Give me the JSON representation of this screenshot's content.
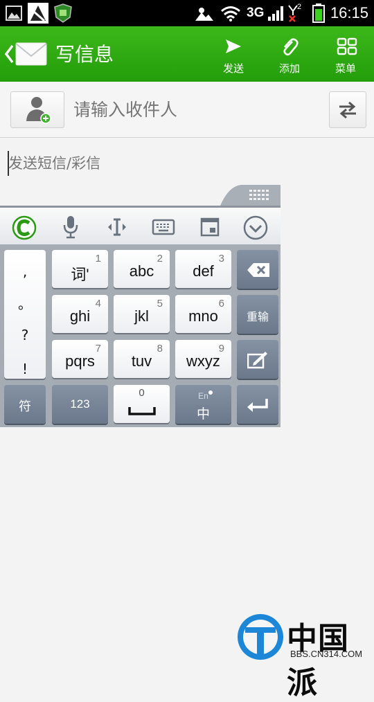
{
  "status_bar": {
    "network": "3G",
    "sim": "2",
    "time": "16:15"
  },
  "header": {
    "title": "写信息",
    "send_label": "发送",
    "attach_label": "添加",
    "menu_label": "菜单"
  },
  "compose": {
    "recipient_placeholder": "请输入收件人",
    "message_placeholder": "发送短信/彩信"
  },
  "keyboard": {
    "punctuation": [
      ",",
      "。",
      "?",
      "!"
    ],
    "rows": [
      [
        {
          "label": "词'",
          "num": "1"
        },
        {
          "label": "abc",
          "num": "2"
        },
        {
          "label": "def",
          "num": "3"
        }
      ],
      [
        {
          "label": "ghi",
          "num": "4"
        },
        {
          "label": "jkl",
          "num": "5"
        },
        {
          "label": "mno",
          "num": "6"
        }
      ],
      [
        {
          "label": "pqrs",
          "num": "7"
        },
        {
          "label": "tuv",
          "num": "8"
        },
        {
          "label": "wxyz",
          "num": "9"
        }
      ]
    ],
    "reinput_label": "重输",
    "symbol_label": "符",
    "num_label": "123",
    "space_num": "0",
    "lang_top": "En",
    "lang_main": "中"
  },
  "watermark": {
    "brand": "中国派",
    "url": "BBS.CN314.COM"
  },
  "colors": {
    "accent_green": "#2aa60f",
    "key_dark": "#77849a"
  }
}
